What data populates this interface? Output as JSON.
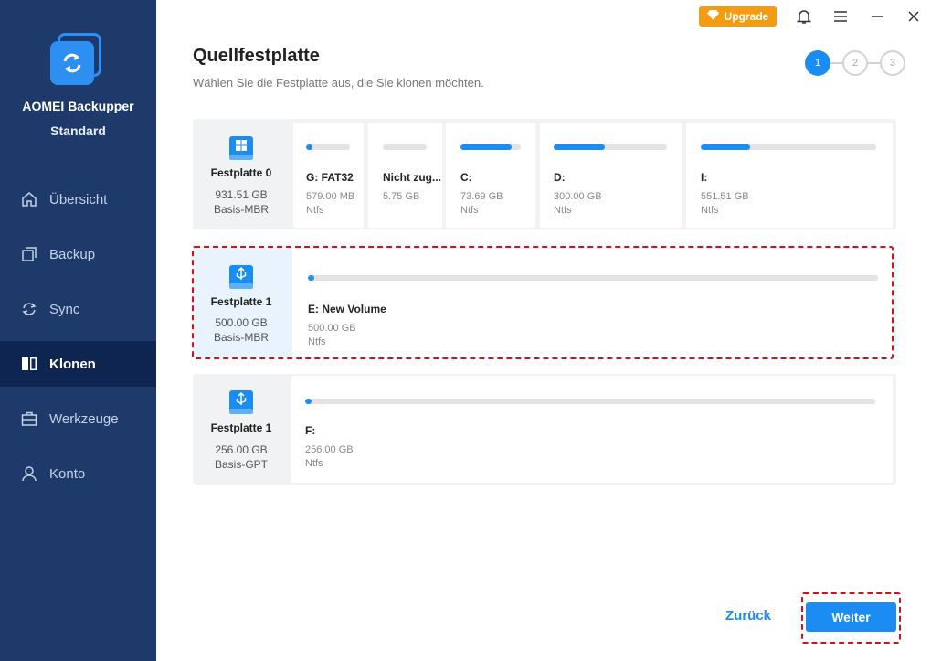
{
  "app": {
    "name": "AOMEI Backupper",
    "edition": "Standard"
  },
  "titlebar": {
    "upgrade_label": "Upgrade"
  },
  "nav": [
    {
      "label": "Übersicht",
      "icon": "home-icon"
    },
    {
      "label": "Backup",
      "icon": "backup-icon"
    },
    {
      "label": "Sync",
      "icon": "sync-icon"
    },
    {
      "label": "Klonen",
      "icon": "clone-icon",
      "active": true
    },
    {
      "label": "Werkzeuge",
      "icon": "toolbox-icon"
    },
    {
      "label": "Konto",
      "icon": "user-icon"
    }
  ],
  "header": {
    "title": "Quellfestplatte",
    "subtitle": "Wählen Sie die Festplatte aus, die Sie klonen möchten."
  },
  "steps": [
    "1",
    "2",
    "3"
  ],
  "disks": [
    {
      "name": "Festplatte 0",
      "size": "931.51 GB",
      "type": "Basis-MBR",
      "icon": "windows-disk-icon",
      "partitions": [
        {
          "label": "G: FAT32",
          "size": "579.00 MB",
          "fs": "Ntfs",
          "used": 0.15
        },
        {
          "label": "Nicht zug...",
          "size": "5.75 GB",
          "fs": "",
          "used": 0
        },
        {
          "label": "C:",
          "size": "73.69 GB",
          "fs": "Ntfs",
          "used": 0.85
        },
        {
          "label": "D:",
          "size": "300.00 GB",
          "fs": "Ntfs",
          "used": 0.45
        },
        {
          "label": "I:",
          "size": "551.51 GB",
          "fs": "Ntfs",
          "used": 0.28
        }
      ]
    },
    {
      "name": "Festplatte 1",
      "size": "500.00 GB",
      "type": "Basis-MBR",
      "icon": "usb-disk-icon",
      "selected": true,
      "partitions": [
        {
          "label": "E: New Volume",
          "size": "500.00 GB",
          "fs": "Ntfs",
          "used": 0.005
        }
      ]
    },
    {
      "name": "Festplatte 1",
      "size": "256.00 GB",
      "type": "Basis-GPT",
      "icon": "usb-disk-icon",
      "partitions": [
        {
          "label": "F:",
          "size": "256.00 GB",
          "fs": "Ntfs",
          "used": 0.005
        }
      ]
    }
  ],
  "footer": {
    "back_label": "Zurück",
    "next_label": "Weiter"
  },
  "colors": {
    "sidebar": "#1e3a6b",
    "sidebar_active": "#0d2550",
    "accent": "#1a8cf2",
    "upgrade": "#f39c12",
    "selection": "#d0121b"
  }
}
